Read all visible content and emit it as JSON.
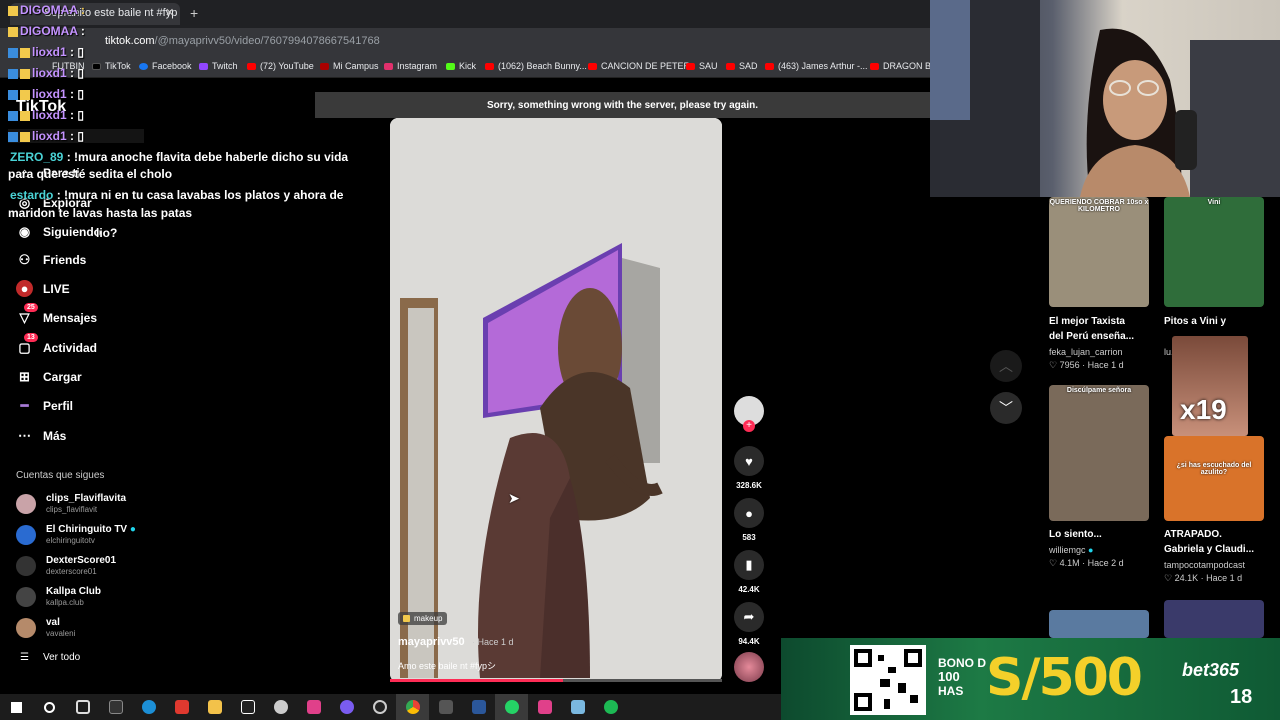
{
  "browser": {
    "tab_title": "Sopranito este baile nt #fyp",
    "url_host": "tiktok.com",
    "url_path": "/@mayaprivv50/video/7607994078667541768",
    "bookmarks": [
      "FUTBIN",
      "TikTok",
      "Facebook",
      "Twitch",
      "(72) YouTube",
      "Mi Campus",
      "Instagram",
      "Kick",
      "(1062) Beach Bunny...",
      "CANCION DE PETER",
      "SAU",
      "SAD",
      "(463) James Arthur -...",
      "DRAGON BAL"
    ]
  },
  "chat": [
    {
      "nick": "DIGOMAA",
      "msg": ""
    },
    {
      "nick": "DIGOMAA",
      "msg": ""
    },
    {
      "nick": "lioxd1",
      "msg": ""
    },
    {
      "nick": "lioxd1",
      "msg": ""
    },
    {
      "nick": "lioxd1",
      "msg": ""
    },
    {
      "nick": "lioxd1",
      "msg": ""
    },
    {
      "nick": "lioxd1",
      "msg": ""
    },
    {
      "nick": "ZERO_89",
      "msg": "!mura anoche flavita debe haberle dicho su vida",
      "cont": "para que esté sedita el cholo"
    },
    {
      "nick": "estardo",
      "msg": "!mura ni en tu casa lavabas los platos y ahora de",
      "cont": "maridon te lavas hasta las patas"
    },
    {
      "nick": "",
      "msg": "lio?"
    }
  ],
  "sidebar": {
    "logo": "TikTok",
    "items": [
      {
        "label": "Para ti",
        "icon": "home-icon"
      },
      {
        "label": "Explorar",
        "icon": "compass-icon"
      },
      {
        "label": "Siguiendo",
        "icon": "following-icon"
      },
      {
        "label": "Friends",
        "icon": "friends-icon"
      },
      {
        "label": "LIVE",
        "icon": "live-icon"
      },
      {
        "label": "Mensajes",
        "icon": "messages-icon",
        "badge": "25"
      },
      {
        "label": "Actividad",
        "icon": "activity-icon",
        "badge": "13"
      },
      {
        "label": "Cargar",
        "icon": "upload-icon"
      },
      {
        "label": "Perfil",
        "icon": "profile-icon"
      },
      {
        "label": "Más",
        "icon": "more-icon"
      }
    ],
    "following_title": "Cuentas que sigues",
    "following": [
      {
        "name": "clips_Flaviflavita",
        "handle": "clips_flaviflavit",
        "color": "#c9a3a8"
      },
      {
        "name": "El Chiringuito TV",
        "handle": "elchiringuitotv",
        "color": "#2a6bd1"
      },
      {
        "name": "DexterScore01",
        "handle": "dexterscore01",
        "color": "#333333"
      },
      {
        "name": "Kallpa Club",
        "handle": "kallpa.club",
        "color": "#444444"
      },
      {
        "name": "val",
        "handle": "vavaleni",
        "color": "#b58a6a"
      }
    ],
    "see_all": "Ver todo"
  },
  "error": "Sorry, something wrong with the server, please try again.",
  "video": {
    "tag": "makeup",
    "username": "mayaprivv50",
    "time": "· Hace 1 d",
    "caption": "Amo este baile nt #fypシ",
    "progress": 0.52,
    "likes": "328.6K",
    "comments": "583",
    "saves": "42.4K",
    "shares": "94.4K"
  },
  "related": [
    {
      "title": "El mejor Taxista",
      "title2": "del Perú enseña...",
      "user": "feka_lujan_carrion",
      "likes": "7956",
      "time": "Hace 1 d",
      "cap": "QUERIENDO COBRAR 10so x KILOMETRO",
      "color": "#9a8f7a"
    },
    {
      "title": "Pitos a Vini y",
      "title2": "",
      "user": "lu...",
      "likes": "",
      "time": "",
      "cap": "Vini",
      "color": "#2f6d3a"
    },
    {
      "title": "Lo siento...",
      "title2": "",
      "user": "williemgc",
      "likes": "4.1M",
      "time": "Hace 2 d",
      "cap": "Discúlpame señora",
      "color": "#7a6a5a"
    },
    {
      "title": "ATRAPADO.",
      "title2": "Gabriela y Claudi...",
      "user": "tampocotampodcast",
      "likes": "24.1K",
      "time": "Hace 1 d",
      "cap": "¿si has escuchado del azulito?",
      "color": "#d9732a"
    }
  ],
  "overlay_x19": "x19",
  "ad": {
    "bono": [
      "BONO D",
      "100",
      "HAS"
    ],
    "amount": "S/500",
    "brand": "bet365",
    "age": "18"
  }
}
